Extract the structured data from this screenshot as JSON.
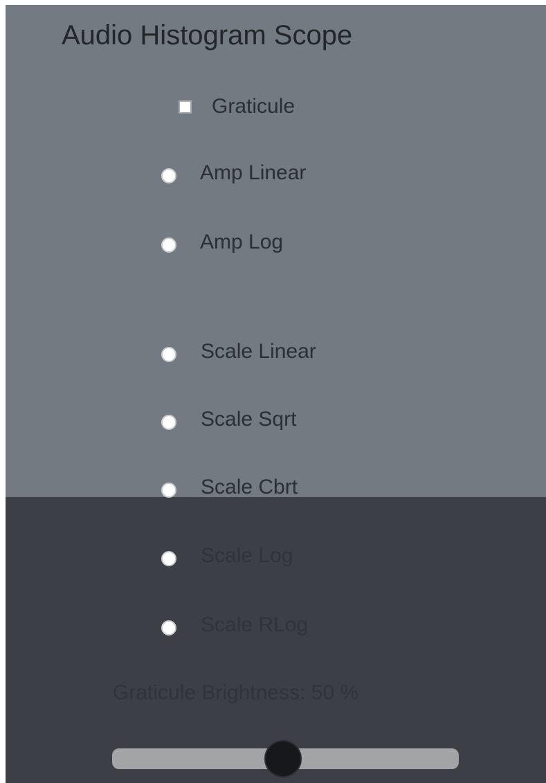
{
  "title": "Audio Histogram Scope",
  "graticule": {
    "label": "Graticule",
    "checked": true
  },
  "amp_options": [
    {
      "label": "Amp Linear"
    },
    {
      "label": "Amp Log"
    }
  ],
  "scale_options": [
    {
      "label": "Scale Linear"
    },
    {
      "label": "Scale Sqrt"
    },
    {
      "label": "Scale Cbrt"
    },
    {
      "label": "Scale Log"
    },
    {
      "label": "Scale RLog"
    }
  ],
  "brightness": {
    "label": "Graticule Brightness: 50 %",
    "value_percent": 50
  },
  "colors": {
    "top_background": "#737a82",
    "bottom_background": "#3c3f45",
    "slider_track": "#a3a4a6",
    "slider_thumb": "#17181b"
  }
}
